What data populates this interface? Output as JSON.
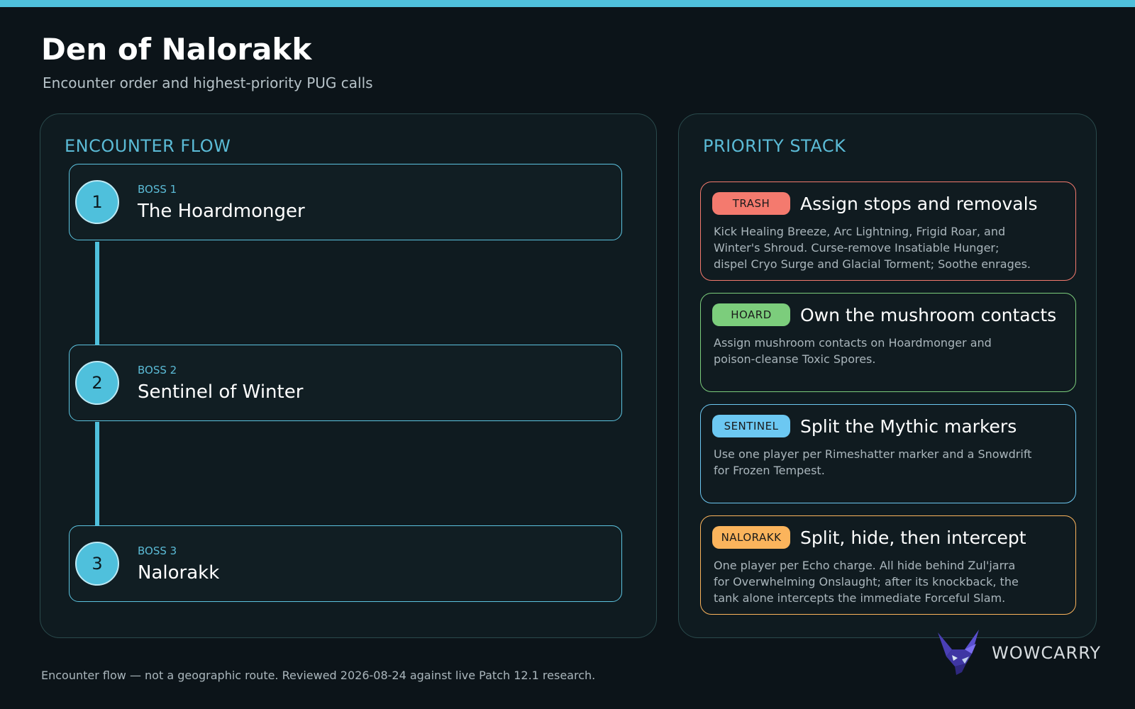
{
  "page": {
    "title": "Den of Nalorakk",
    "subtitle": "Encounter order and highest-priority PUG calls",
    "accent_color": "#4fc0dc"
  },
  "encounter_flow": {
    "heading": "ENCOUNTER FLOW",
    "bosses": [
      {
        "number": "1",
        "label": "BOSS 1",
        "name": "The Hoardmonger"
      },
      {
        "number": "2",
        "label": "BOSS 2",
        "name": "Sentinel of Winter"
      },
      {
        "number": "3",
        "label": "BOSS 3",
        "name": "Nalorakk"
      }
    ]
  },
  "priority_stack": {
    "heading": "PRIORITY STACK",
    "items": [
      {
        "badge": "TRASH",
        "title": "Assign stops and removals",
        "body": "Kick Healing Breeze, Arc Lightning, Frigid Roar, and Winter's Shroud. Curse-remove Insatiable Hunger; dispel Cryo Surge and Glacial Torment; Soothe enrages.",
        "color": "#f47a6e"
      },
      {
        "badge": "HOARD",
        "title": "Own the mushroom contacts",
        "body": "Assign mushroom contacts on Hoardmonger and poison-cleanse Toxic Spores.",
        "color": "#7ccd7c"
      },
      {
        "badge": "SENTINEL",
        "title": "Split the Mythic markers",
        "body": "Use one player per Rimeshatter marker and a Snowdrift for Frozen Tempest.",
        "color": "#6cc8f2"
      },
      {
        "badge": "NALORAKK",
        "title": "Split, hide, then intercept",
        "body": "One player per Echo charge. All hide behind Zul'jarra for Overwhelming Onslaught; after its knockback, the tank alone intercepts the immediate Forceful Slam.",
        "color": "#fbb45c"
      }
    ]
  },
  "branding": {
    "logo_icon": "fox-icon",
    "logo_text": "WOWCARRY"
  },
  "footer": {
    "note": "Encounter flow — not a geographic route. Reviewed 2026-08-24 against live Patch 12.1 research."
  }
}
